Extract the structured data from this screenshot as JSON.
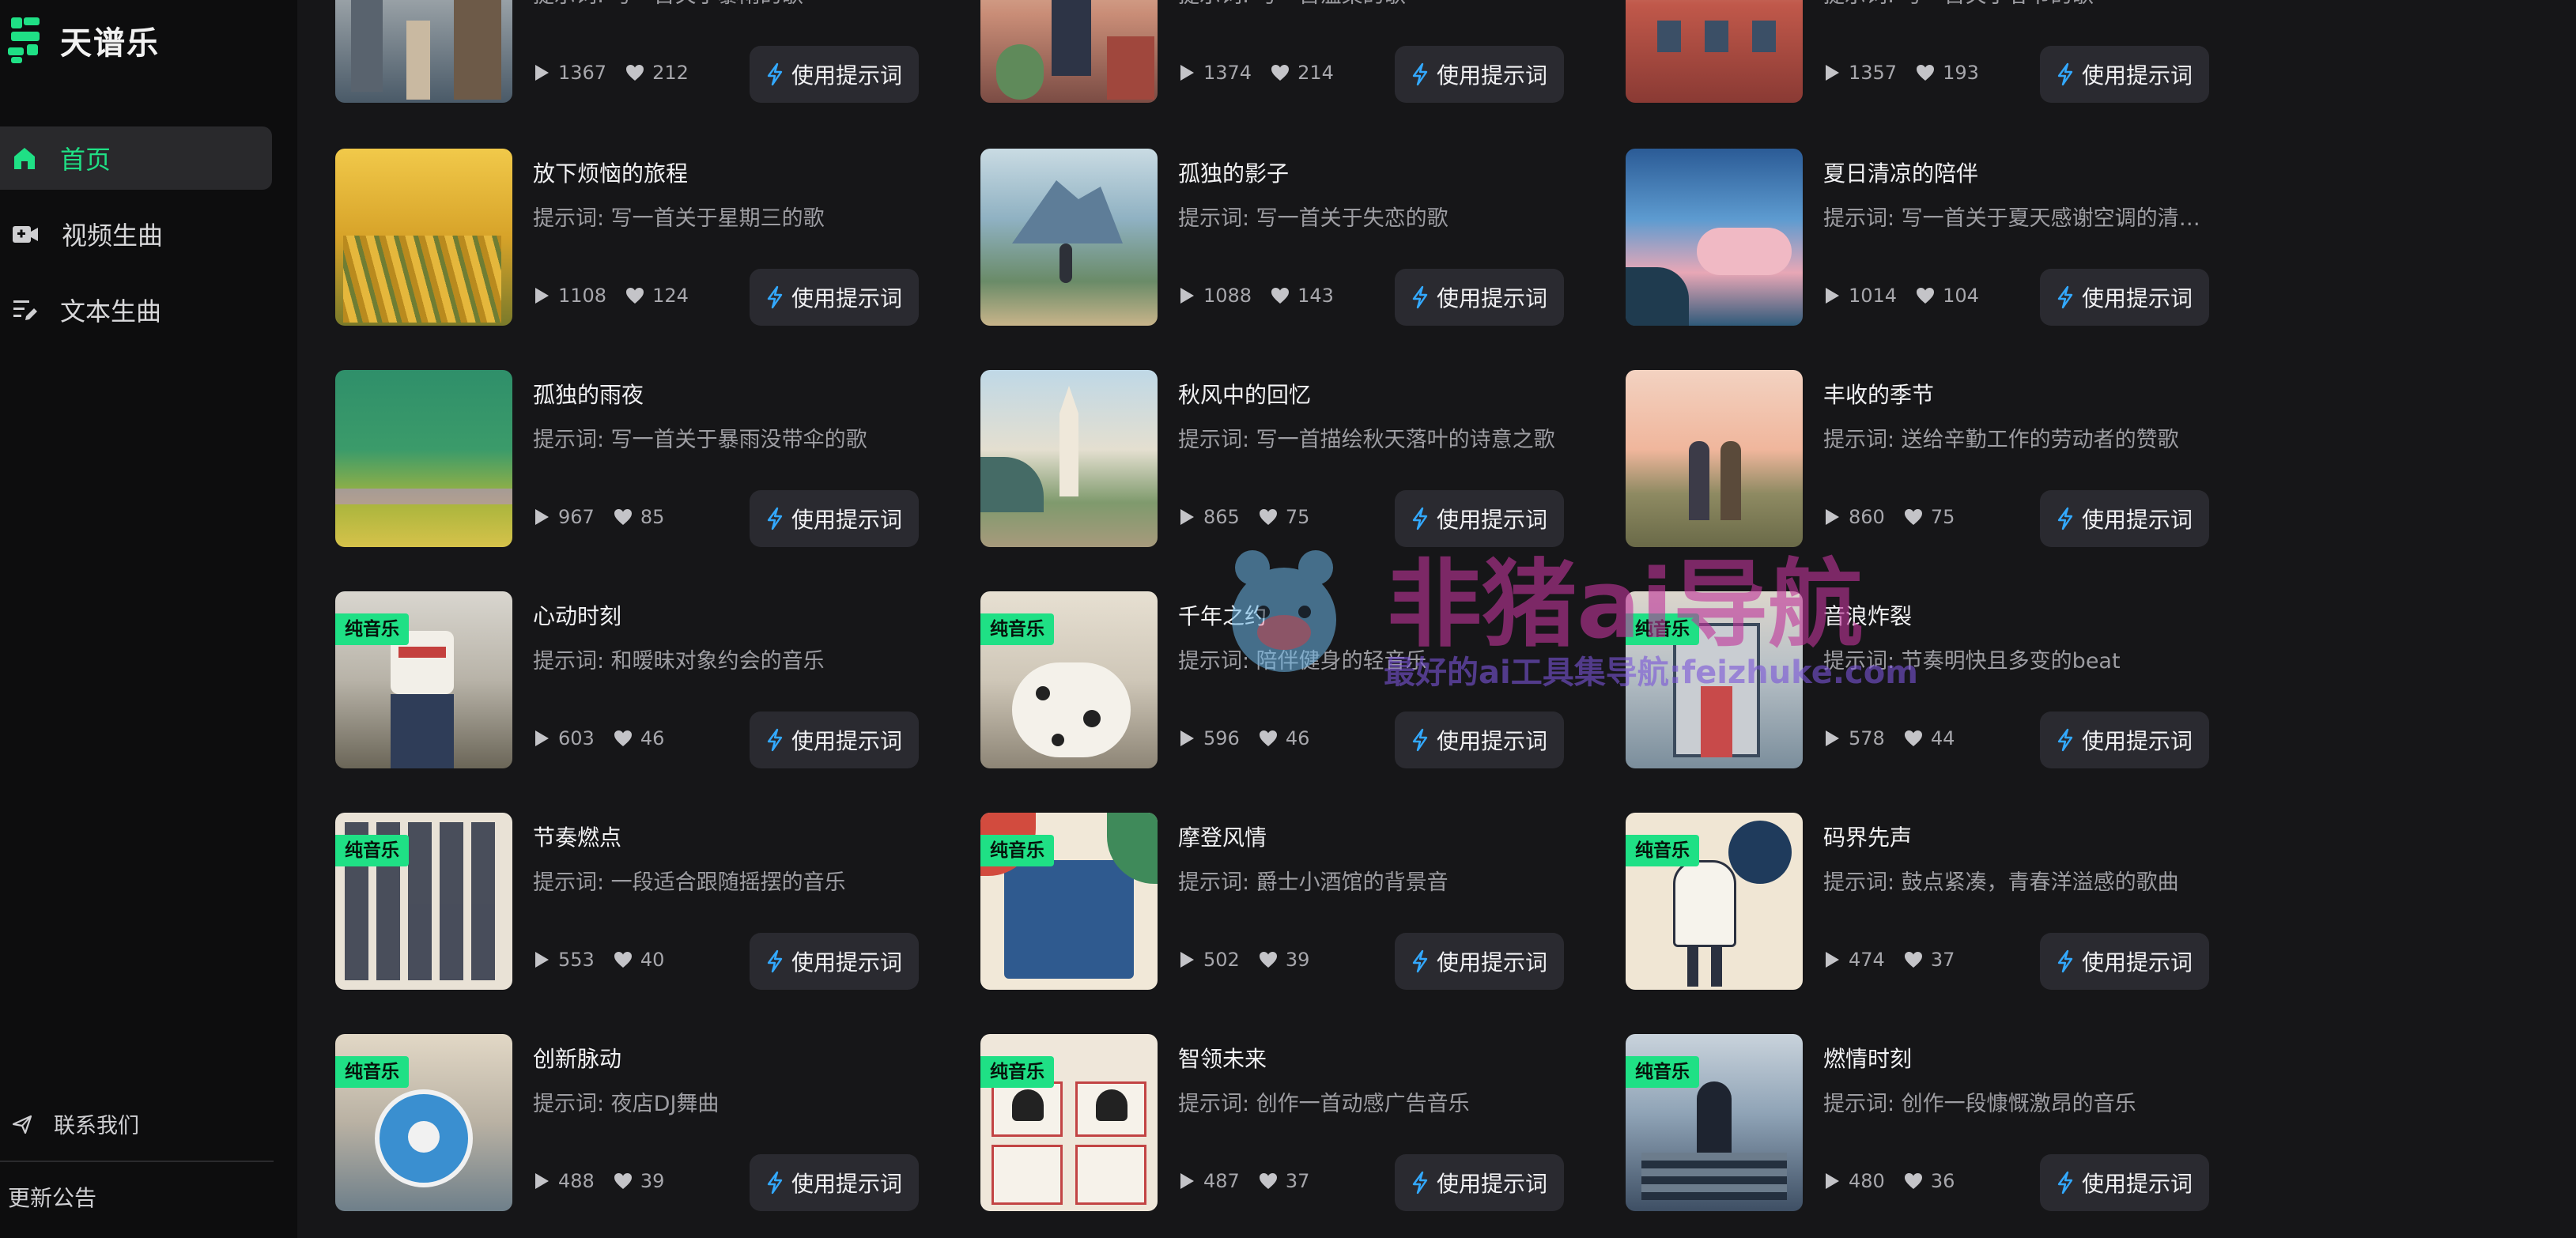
{
  "brand": {
    "name": "天谱乐",
    "accent": "#1fe085"
  },
  "sidebar": {
    "items": [
      {
        "label": "首页",
        "icon": "home-icon",
        "active": true
      },
      {
        "label": "视频生曲",
        "icon": "video-icon",
        "active": false
      },
      {
        "label": "文本生曲",
        "icon": "text-edit-icon",
        "active": false
      }
    ],
    "contact": "联系我们",
    "update": "更新公告"
  },
  "use_label": "使用提示词",
  "watermark": {
    "title": "非猪ai导航",
    "subtitle": "最好的ai工具集导航:feizhuke.com"
  },
  "cards": [
    {
      "title": "",
      "prompt": "提示词: 写一首关于暴雨的歌",
      "plays": "1367",
      "likes": "212",
      "badge": ""
    },
    {
      "title": "",
      "prompt": "提示词: 写一首温柔的歌",
      "plays": "1374",
      "likes": "214",
      "badge": ""
    },
    {
      "title": "",
      "prompt": "提示词: 写一首关于春节的歌",
      "plays": "1357",
      "likes": "193",
      "badge": ""
    },
    {
      "title": "放下烦恼的旅程",
      "prompt": "提示词: 写一首关于星期三的歌",
      "plays": "1108",
      "likes": "124",
      "badge": ""
    },
    {
      "title": "孤独的影子",
      "prompt": "提示词: 写一首关于失恋的歌",
      "plays": "1088",
      "likes": "143",
      "badge": ""
    },
    {
      "title": "夏日清凉的陪伴",
      "prompt": "提示词: 写一首关于夏天感谢空调的清凉歌曲",
      "plays": "1014",
      "likes": "104",
      "badge": ""
    },
    {
      "title": "孤独的雨夜",
      "prompt": "提示词: 写一首关于暴雨没带伞的歌",
      "plays": "967",
      "likes": "85",
      "badge": ""
    },
    {
      "title": "秋风中的回忆",
      "prompt": "提示词: 写一首描绘秋天落叶的诗意之歌",
      "plays": "865",
      "likes": "75",
      "badge": ""
    },
    {
      "title": "丰收的季节",
      "prompt": "提示词: 送给辛勤工作的劳动者的赞歌",
      "plays": "860",
      "likes": "75",
      "badge": ""
    },
    {
      "title": "心动时刻",
      "prompt": "提示词: 和暧昧对象约会的音乐",
      "plays": "603",
      "likes": "46",
      "badge": "纯音乐"
    },
    {
      "title": "千年之约",
      "prompt": "提示词: 陪伴健身的轻音乐",
      "plays": "596",
      "likes": "46",
      "badge": "纯音乐"
    },
    {
      "title": "音浪炸裂",
      "prompt": "提示词: 节奏明快且多变的beat",
      "plays": "578",
      "likes": "44",
      "badge": "纯音乐"
    },
    {
      "title": "节奏燃点",
      "prompt": "提示词: 一段适合跟随摇摆的音乐",
      "plays": "553",
      "likes": "40",
      "badge": "纯音乐"
    },
    {
      "title": "摩登风情",
      "prompt": "提示词: 爵士小酒馆的背景音",
      "plays": "502",
      "likes": "39",
      "badge": "纯音乐"
    },
    {
      "title": "码界先声",
      "prompt": "提示词: 鼓点紧凑，青春洋溢感的歌曲",
      "plays": "474",
      "likes": "37",
      "badge": "纯音乐"
    },
    {
      "title": "创新脉动",
      "prompt": "提示词: 夜店DJ舞曲",
      "plays": "488",
      "likes": "39",
      "badge": "纯音乐"
    },
    {
      "title": "智领未来",
      "prompt": "提示词: 创作一首动感广告音乐",
      "plays": "487",
      "likes": "37",
      "badge": "纯音乐"
    },
    {
      "title": "燃情时刻",
      "prompt": "提示词: 创作一段慷慨激昂的音乐",
      "plays": "480",
      "likes": "36",
      "badge": "纯音乐"
    }
  ]
}
